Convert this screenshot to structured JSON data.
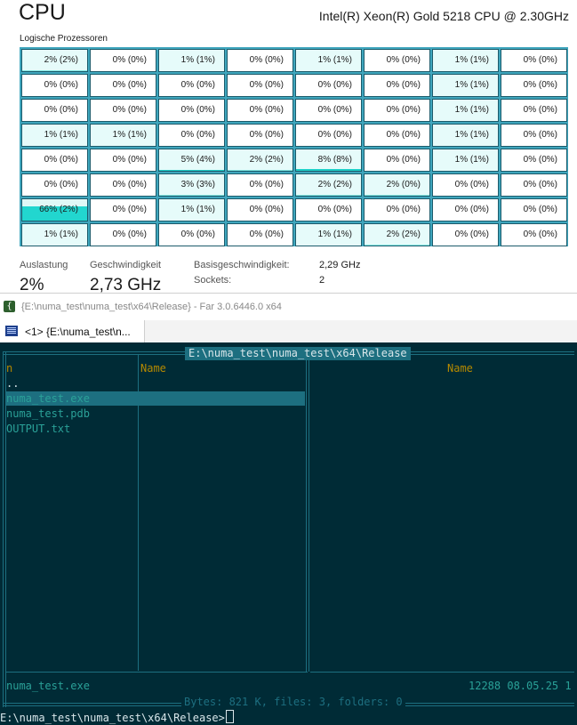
{
  "taskmanager": {
    "title": "CPU",
    "cpu_name": "Intel(R) Xeon(R) Gold 5218 CPU @ 2.30GHz",
    "subtitle": "Logische Prozessoren",
    "cells": [
      "2% (2%)",
      "0% (0%)",
      "1% (1%)",
      "0% (0%)",
      "1% (1%)",
      "0% (0%)",
      "1% (1%)",
      "0% (0%)",
      "0% (0%)",
      "0% (0%)",
      "0% (0%)",
      "0% (0%)",
      "0% (0%)",
      "0% (0%)",
      "1% (1%)",
      "0% (0%)",
      "0% (0%)",
      "0% (0%)",
      "0% (0%)",
      "0% (0%)",
      "0% (0%)",
      "0% (0%)",
      "1% (1%)",
      "0% (0%)",
      "1% (1%)",
      "1% (1%)",
      "0% (0%)",
      "0% (0%)",
      "0% (0%)",
      "0% (0%)",
      "1% (1%)",
      "0% (0%)",
      "0% (0%)",
      "0% (0%)",
      "5% (4%)",
      "2% (2%)",
      "8% (8%)",
      "0% (0%)",
      "1% (1%)",
      "0% (0%)",
      "0% (0%)",
      "0% (0%)",
      "3% (3%)",
      "0% (0%)",
      "2% (2%)",
      "2% (0%)",
      "0% (0%)",
      "0% (0%)",
      "66% (2%)",
      "0% (0%)",
      "1% (1%)",
      "0% (0%)",
      "0% (0%)",
      "0% (0%)",
      "0% (0%)",
      "0% (0%)",
      "1% (1%)",
      "0% (0%)",
      "0% (0%)",
      "0% (0%)",
      "1% (1%)",
      "2% (2%)",
      "0% (0%)",
      "0% (0%)"
    ],
    "stats": {
      "auslastung_label": "Auslastung",
      "auslastung_value": "2%",
      "geschw_label": "Geschwindigkeit",
      "geschw_value": "2,73 GHz",
      "basis_label": "Basisgeschwindigkeit:",
      "basis_value": "2,29 GHz",
      "sockets_label": "Sockets:",
      "sockets_value": "2"
    }
  },
  "far": {
    "window_title": "{E:\\numa_test\\numa_test\\x64\\Release} - Far 3.0.6446.0 x64",
    "tab_label": "<1> {E:\\numa_test\\n...",
    "panel_path": "E:\\numa_test\\numa_test\\x64\\Release",
    "left_col_n": "n",
    "left_col_name": "Name",
    "right_col_name": "Name",
    "updir": "..",
    "files": [
      "numa_test.exe",
      "numa_test.pdb",
      "OUTPUT.txt"
    ],
    "selected_file": "numa_test.exe",
    "info_size": "12288 08.05.25 1",
    "bytes_line": "Bytes: 821 K, files: 3, folders: 0",
    "prompt": "E:\\numa_test\\numa_test\\x64\\Release>"
  },
  "colors": {
    "console_bg": "#002b36",
    "accent": "#1d6f80",
    "file_text": "#2aa198",
    "heading_text": "#b58900",
    "cell_border": "#1c5b6b",
    "cell_fill_scale": "#1ed0c8"
  },
  "icons": [
    "far-app-icon",
    "console-tab-icon"
  ]
}
